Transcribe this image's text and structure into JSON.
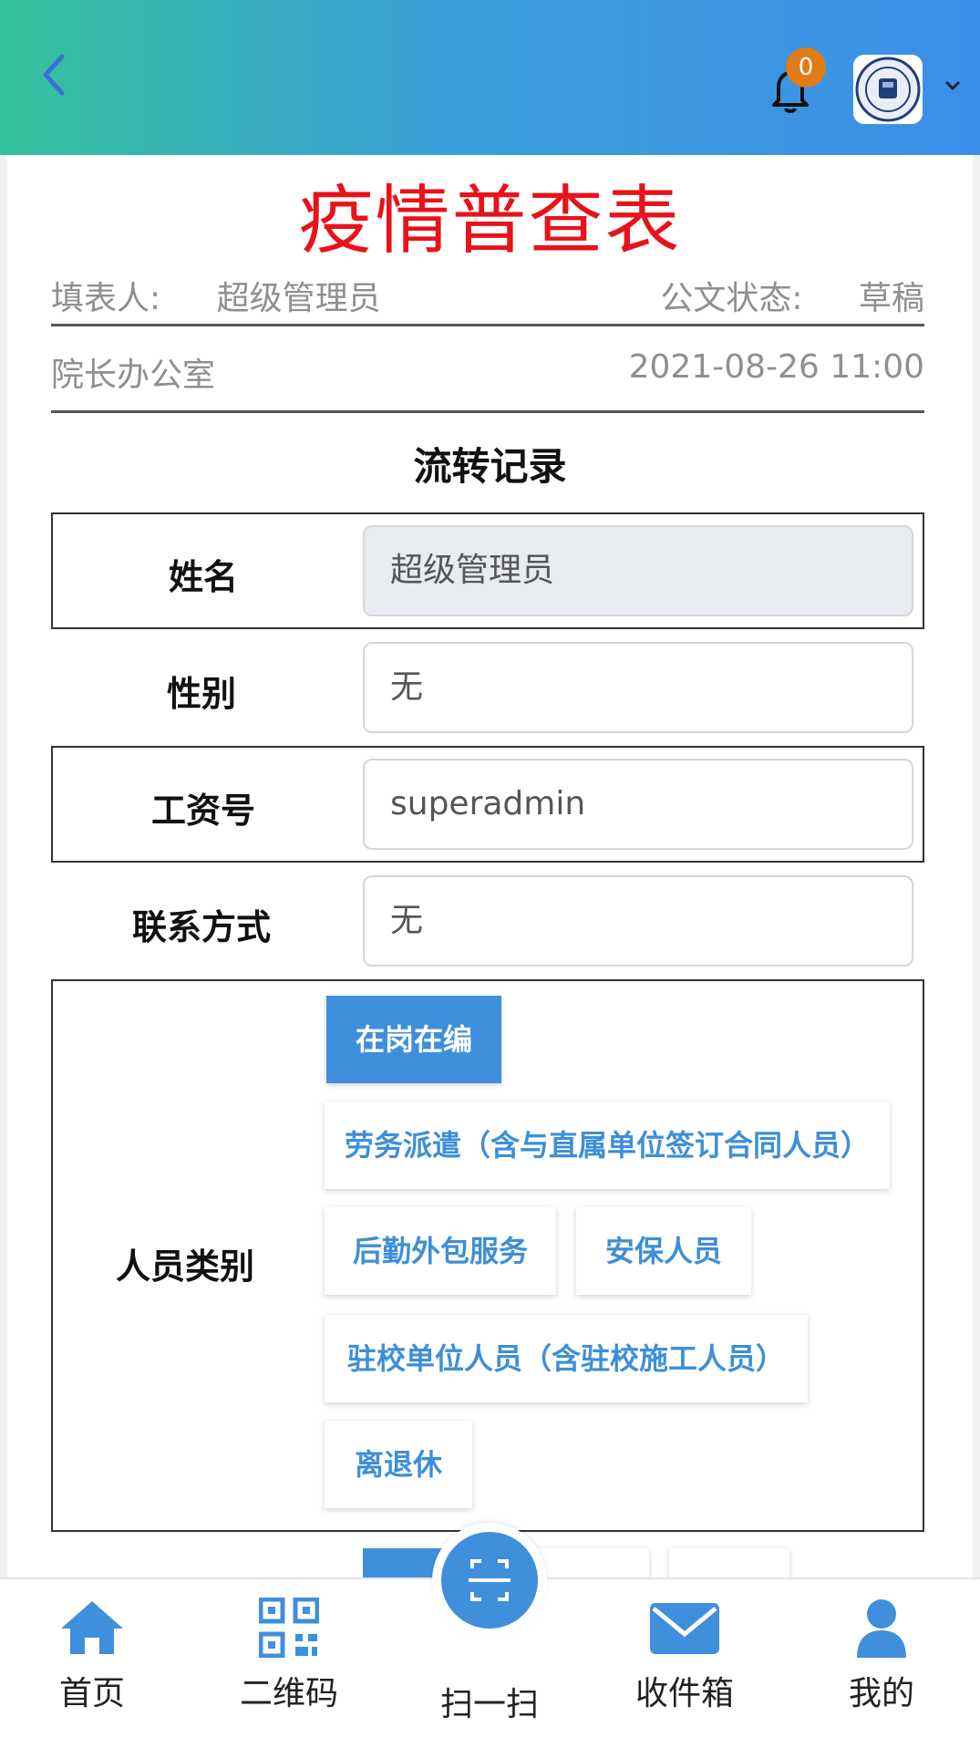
{
  "header": {
    "notification_count": "0"
  },
  "document": {
    "title": "疫情普查表",
    "filler_label": "填表人:",
    "filler_value": "超级管理员",
    "status_label": "公文状态:",
    "status_value": "草稿",
    "department": "院长办公室",
    "datetime": "2021-08-26 11:00",
    "section_title": "流转记录"
  },
  "form": {
    "name_label": "姓名",
    "name_value": "超级管理员",
    "gender_label": "性别",
    "gender_value": "无",
    "employee_id_label": "工资号",
    "employee_id_value": "superadmin",
    "contact_label": "联系方式",
    "contact_value": "无",
    "category_label": "人员类别",
    "category_options": [
      "在岗在编",
      "劳务派遣（含与直属单位签订合同人员）",
      "后勤外包服务",
      "安保人员",
      "驻校单位人员（含驻校施工人员）",
      "离退休"
    ],
    "category_selected": "在岗在编"
  },
  "bottom_nav": {
    "home": "首页",
    "qrcode": "二维码",
    "scan": "扫一扫",
    "inbox": "收件箱",
    "mine": "我的"
  },
  "colors": {
    "title_red": "#e8121a",
    "accent_blue": "#3f8fdc",
    "badge_orange": "#e07b16"
  }
}
